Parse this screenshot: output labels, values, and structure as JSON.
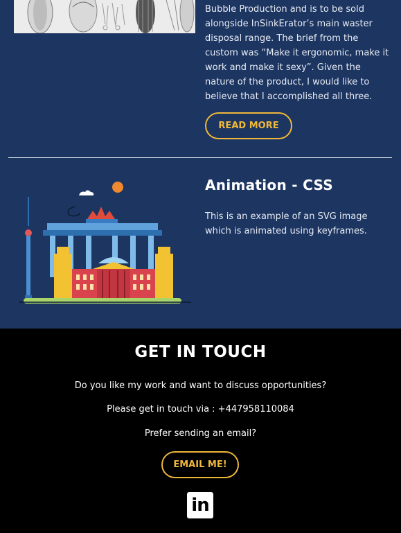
{
  "project_top": {
    "description": "Bubble Production and is to be sold alongside InSinkErator’s main waster disposal range. The brief from the custom was “Make it ergonomic, make it work and make it sexy”. Given the nature of the product, I would like to believe that I accomplished all three.",
    "read_more_label": "READ MORE",
    "thumbnail_icon": "product-sketch-image"
  },
  "project_animation": {
    "title": "Animation - CSS",
    "description": "This is an example of an SVG image which is animated using keyframes.",
    "illustration_icon": "brandenburg-gate-city-illustration"
  },
  "contact": {
    "title": "GET IN TOUCH",
    "line1": "Do you like my work and want to discuss opportunities?",
    "line2": "Please get in touch via : +447958110084",
    "line3": "Prefer sending an email?",
    "email_label": "EMAIL ME!",
    "linkedin_label": "in"
  },
  "colors": {
    "section_bg": "#1c3561",
    "accent": "#f0b83a",
    "footer_bg": "#000000"
  }
}
